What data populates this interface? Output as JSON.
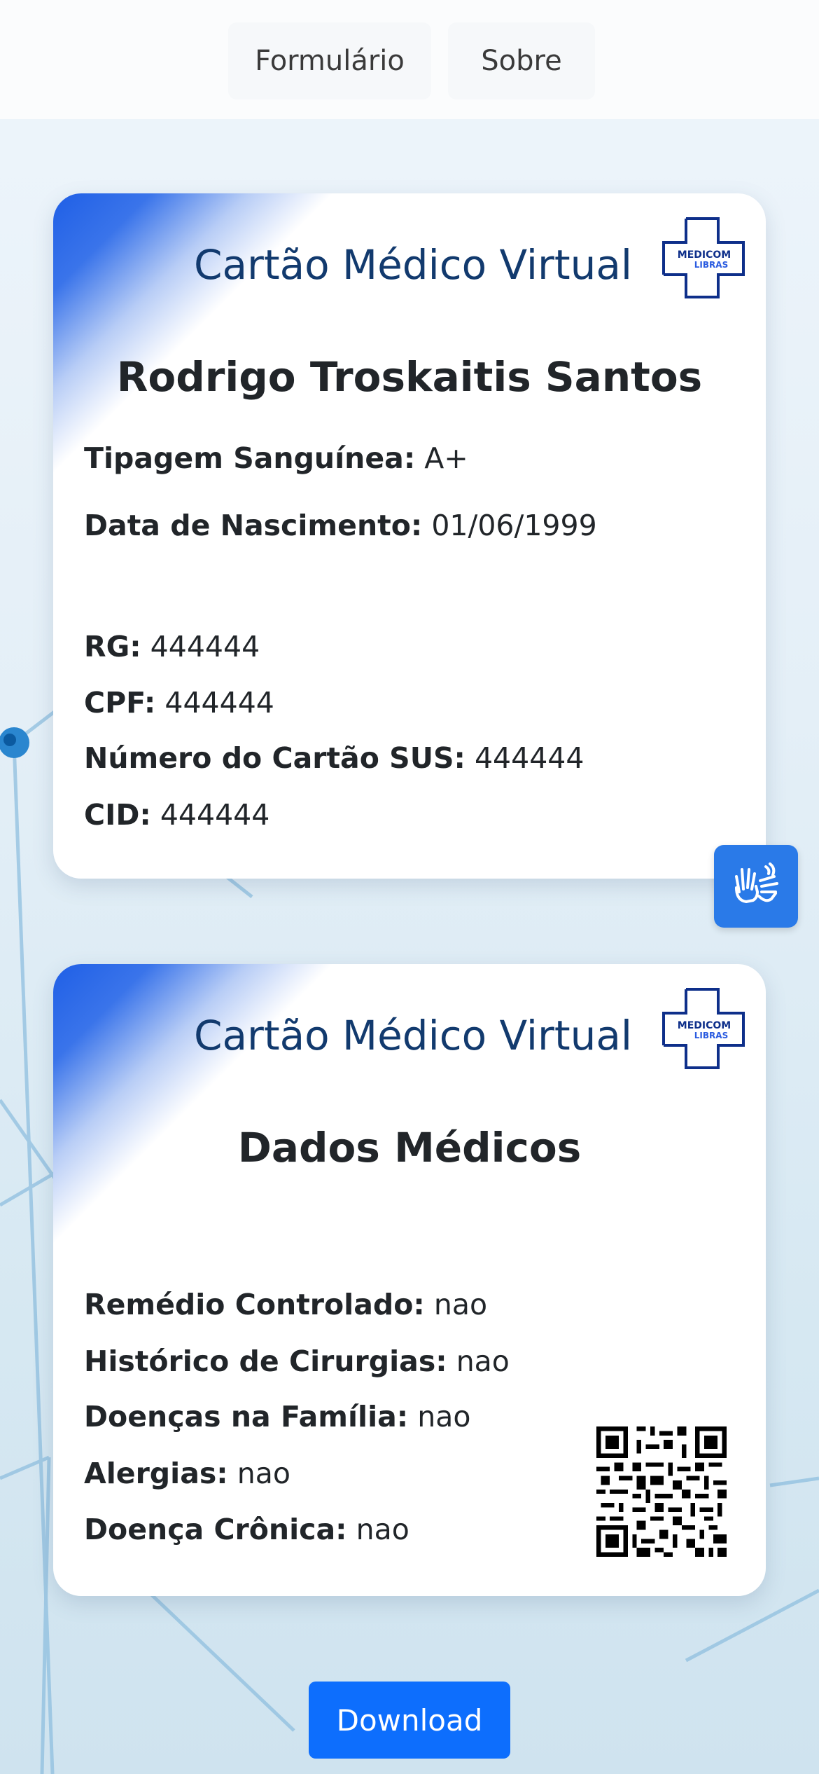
{
  "nav": {
    "items": [
      {
        "label": "Formulário"
      },
      {
        "label": "Sobre"
      }
    ]
  },
  "card1": {
    "title": "Cartão Médico Virtual",
    "logo_text_top": "MEDICOM",
    "logo_text_bottom": "LIBRAS",
    "name": "Rodrigo Troskaitis Santos",
    "fields": [
      {
        "label": "Tipagem Sanguínea:",
        "value": "A+"
      },
      {
        "label": "Data de Nascimento:",
        "value": "01/06/1999"
      },
      {
        "label": "RG:",
        "value": "444444"
      },
      {
        "label": "CPF:",
        "value": "444444"
      },
      {
        "label": "Número do Cartão SUS:",
        "value": "444444"
      },
      {
        "label": "CID:",
        "value": "444444"
      }
    ]
  },
  "card2": {
    "title": "Cartão Médico Virtual",
    "logo_text_top": "MEDICOM",
    "logo_text_bottom": "LIBRAS",
    "heading": "Dados Médicos",
    "fields": [
      {
        "label": "Remédio Controlado:",
        "value": "nao"
      },
      {
        "label": "Histórico de Cirurgias:",
        "value": "nao"
      },
      {
        "label": "Doenças na Família:",
        "value": "nao"
      },
      {
        "label": "Alergias:",
        "value": "nao"
      },
      {
        "label": "Doença Crônica:",
        "value": "nao"
      }
    ]
  },
  "download_label": "Download",
  "icons": {
    "libras": "sign-language-icon",
    "qr": "qr-code-icon"
  },
  "colors": {
    "primary": "#0d6efd",
    "title": "#123a6e",
    "libras_button": "#2a7ae8"
  }
}
